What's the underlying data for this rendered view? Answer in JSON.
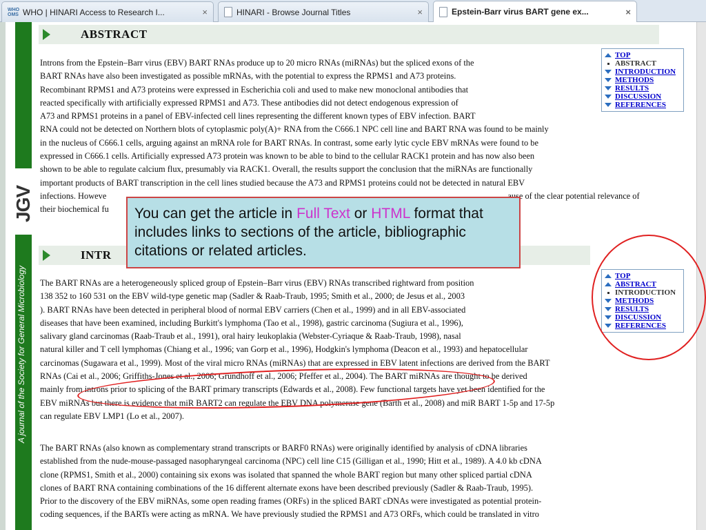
{
  "tabs": [
    {
      "label": "WHO | HINARI Access to Research I...",
      "icon": "who-icon",
      "active": false
    },
    {
      "label": "HINARI - Browse Journal Titles",
      "icon": "page-icon",
      "active": false
    },
    {
      "label": "Epstein-Barr virus BART gene ex...",
      "icon": "page-icon",
      "active": true
    }
  ],
  "favicon_text": "WHO OMS",
  "close_glyph": "×",
  "journal": {
    "logo": "JGV",
    "tagline": "A journal of the Society for General Microbiology"
  },
  "abstract": {
    "heading": "ABSTRACT",
    "lines": [
      "Introns from the Epstein–Barr virus (EBV) BART RNAs produce up to 20 micro RNAs (miRNAs) but the spliced exons of the",
      "BART RNAs have also been investigated as possible mRNAs, with the potential to express the RPMS1 and A73 proteins.",
      "Recombinant RPMS1 and A73 proteins were expressed in Escherichia coli and used to make new monoclonal antibodies that",
      "reacted specifically with artificially expressed RPMS1 and A73. These antibodies did not detect endogenous expression of",
      "A73 and RPMS1 proteins in a panel of EBV-infected cell lines representing the different known types of EBV infection. BART",
      "RNA could not be detected on Northern blots of cytoplasmic poly(A)+ RNA from the C666.1 NPC cell line and BART RNA was found to be mainly",
      "in the nucleus of C666.1 cells, arguing against an mRNA role for BART RNAs. In contrast, some early lytic cycle EBV mRNAs were found to be",
      "expressed in C666.1 cells. Artificially expressed A73 protein was known to be able to bind to the cellular RACK1 protein and has now also been",
      "shown to be able to regulate calcium flux, presumably via RACK1. Overall, the results support the conclusion that the miRNAs are functionally",
      "important products of BART transcription in the cell lines studied because the A73 and RPMS1 proteins could not be detected in natural EBV",
      "infections. Howeve",
      "their biochemical fu"
    ],
    "line11_tail": "ause of the clear potential relevance of"
  },
  "intro": {
    "heading": "INTR",
    "para1": [
      "The BART RNAs are a heterogeneously spliced group of Epstein–Barr virus (EBV) RNAs transcribed rightward from position",
      "138 352 to 160 531 on the EBV wild-type genetic map (Sadler & Raab-Traub, 1995; Smith et al., 2000; de Jesus et al., 2003",
      "). BART RNAs have been detected in peripheral blood of normal EBV carriers (Chen et al., 1999) and in all EBV-associated",
      "diseases that have been examined, including Burkitt's lymphoma (Tao et al., 1998), gastric carcinoma (Sugiura et al., 1996),",
      "salivary gland carcinomas (Raab-Traub et al., 1991), oral hairy leukoplakia (Webster-Cyriaque & Raab-Traub, 1998), nasal",
      "natural killer and T cell lymphomas (Chiang et al., 1996; van Gorp et al., 1996), Hodgkin's lymphoma (Deacon et al., 1993) and hepatocellular",
      "carcinomas (Sugawara et al., 1999). Most of the viral micro RNAs (miRNAs) that are expressed in EBV latent infections are derived from the BART",
      "RNAs (Cai et al., 2006; Griffiths-Jones et al., 2006; Grundhoff et al., 2006; Pfeffer et al., 2004). The BART miRNAs are thought to be derived",
      "mainly from introns prior to splicing of the BART primary transcripts (Edwards et al., 2008). Few functional targets have yet been identified for the",
      "EBV miRNAs but there is evidence that miR BART2 can regulate the EBV DNA polymerase gene (Barth et al., 2008) and miR BART 1-5p and 17-5p",
      "can regulate EBV LMP1 (Lo et al., 2007)."
    ],
    "para2": [
      "The BART RNAs (also known as complementary strand transcripts or BARF0 RNAs) were originally identified by analysis of cDNA libraries",
      "established from the nude-mouse-passaged nasopharyngeal carcinoma (NPC) cell line C15 (Gilligan et al., 1990; Hitt et al., 1989). A 4.0 kb cDNA",
      "clone (RPMS1, Smith et al., 2000) containing six exons was isolated that spanned the whole BART region but many other spliced partial cDNA",
      "clones of BART RNA containing combinations of the 16 different alternate exons have been described previously (Sadler & Raab-Traub, 1995).",
      "Prior to the discovery of the EBV miRNAs, some open reading frames (ORFs) in the spliced BART cDNAs were investigated as potential protein-",
      "coding sequences, if the BARTs were acting as mRNA. We have previously studied the RPMS1 and A73 ORFs, which could be translated in vitro"
    ]
  },
  "nav_abstract": [
    {
      "label": "TOP",
      "icon": "arrow-up-icon",
      "link": true
    },
    {
      "label": "ABSTRACT",
      "icon": "bullet-icon",
      "link": false
    },
    {
      "label": "INTRODUCTION",
      "icon": "arrow-down-icon",
      "link": true
    },
    {
      "label": "METHODS",
      "icon": "arrow-down-icon",
      "link": true
    },
    {
      "label": "RESULTS",
      "icon": "arrow-down-icon",
      "link": true
    },
    {
      "label": "DISCUSSION",
      "icon": "arrow-down-icon",
      "link": true
    },
    {
      "label": "REFERENCES",
      "icon": "arrow-down-icon",
      "link": true
    }
  ],
  "nav_intro": [
    {
      "label": "TOP",
      "icon": "arrow-up-icon",
      "link": true
    },
    {
      "label": "ABSTRACT",
      "icon": "arrow-up-icon",
      "link": true
    },
    {
      "label": "INTRODUCTION",
      "icon": "bullet-icon",
      "link": false
    },
    {
      "label": "METHODS",
      "icon": "arrow-down-icon",
      "link": true
    },
    {
      "label": "RESULTS",
      "icon": "arrow-down-icon",
      "link": true
    },
    {
      "label": "DISCUSSION",
      "icon": "arrow-down-icon",
      "link": true
    },
    {
      "label": "REFERENCES",
      "icon": "arrow-down-icon",
      "link": true
    }
  ],
  "callout": {
    "part1": "You can get the article in ",
    "full_text": "Full Text",
    "part2": " or ",
    "html": "HTML",
    "part3": " format that includes links to sections of the article, bibliographic citations or related articles."
  },
  "colors": {
    "accent_green": "#2c8a2c",
    "link_blue": "#0000cc",
    "callout_bg": "#b7dfe6",
    "callout_highlight": "#cc33cc",
    "annotation_red": "#e02020"
  }
}
